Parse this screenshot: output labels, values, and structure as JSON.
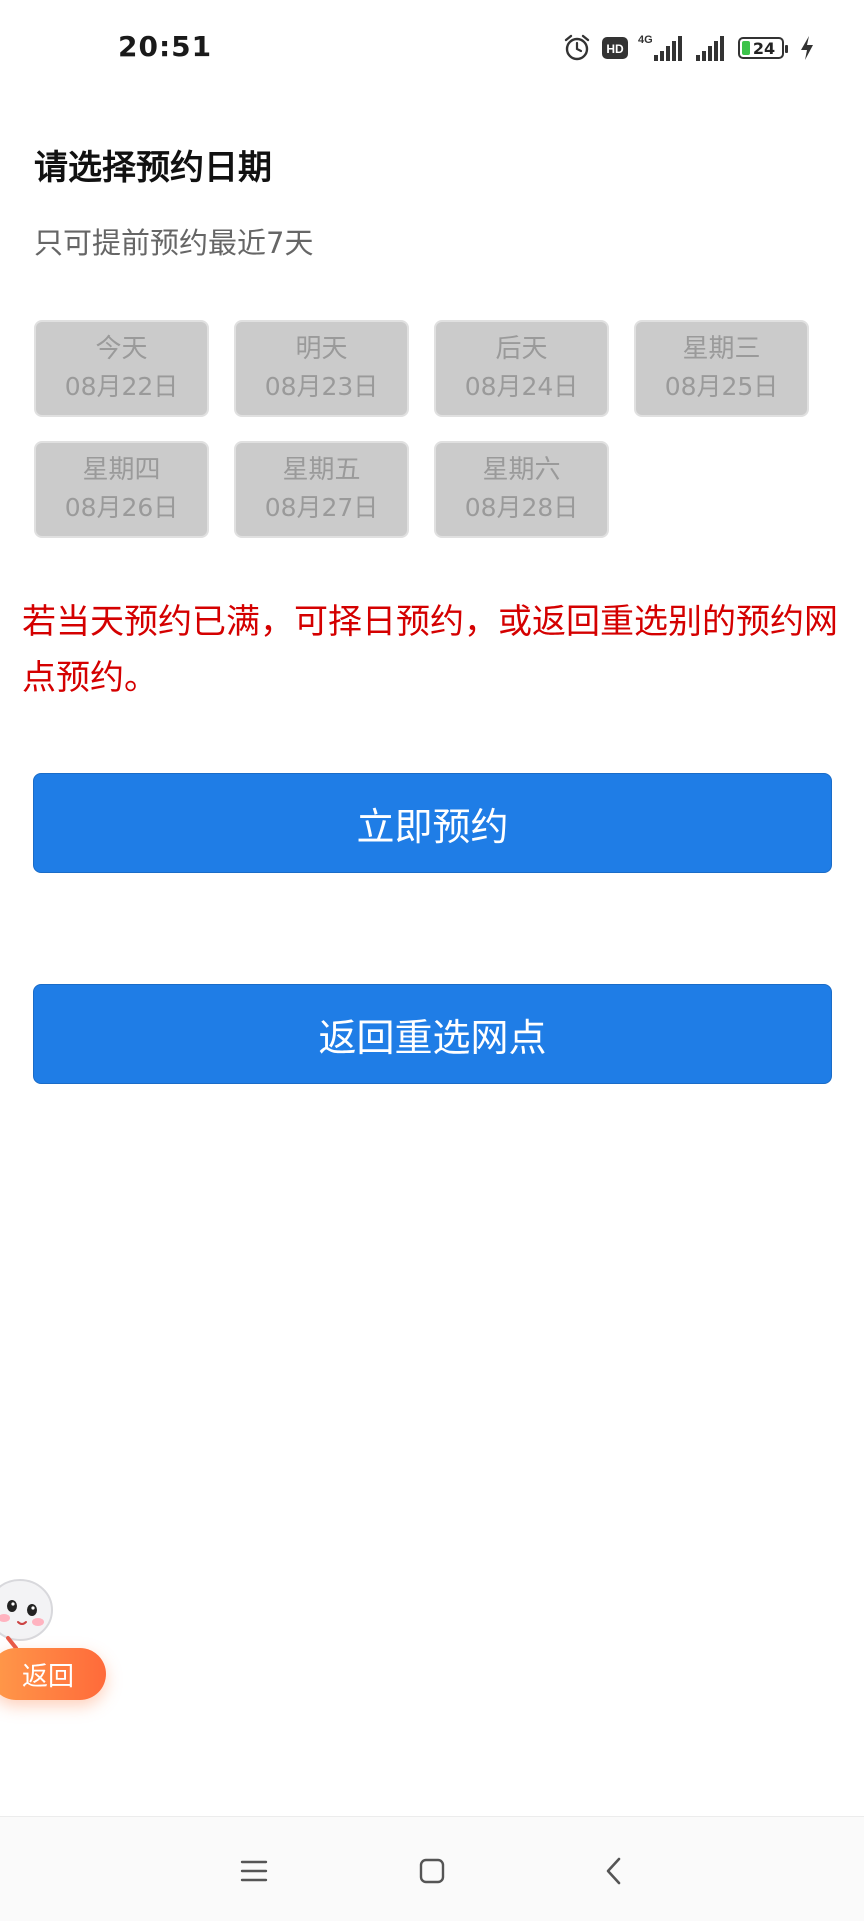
{
  "status_bar": {
    "time": "20:51",
    "network": "4G",
    "hd": "HD",
    "battery": "24"
  },
  "header": {
    "title": "请选择预约日期",
    "subtitle": "只可提前预约最近7天"
  },
  "dates": [
    {
      "day": "今天",
      "date": "08月22日"
    },
    {
      "day": "明天",
      "date": "08月23日"
    },
    {
      "day": "后天",
      "date": "08月24日"
    },
    {
      "day": "星期三",
      "date": "08月25日"
    },
    {
      "day": "星期四",
      "date": "08月26日"
    },
    {
      "day": "星期五",
      "date": "08月27日"
    },
    {
      "day": "星期六",
      "date": "08月28日"
    }
  ],
  "notice": "若当天预约已满，可择日预约，或返回重选别的预约网点预约。",
  "buttons": {
    "reserve": "立即预约",
    "back_outlet": "返回重选网点"
  },
  "float_back": {
    "label": "返回"
  },
  "colors": {
    "primary": "#1f7de6",
    "notice": "#d40000",
    "date_bg": "#cbcbcb",
    "date_text": "#9a9a9a"
  }
}
